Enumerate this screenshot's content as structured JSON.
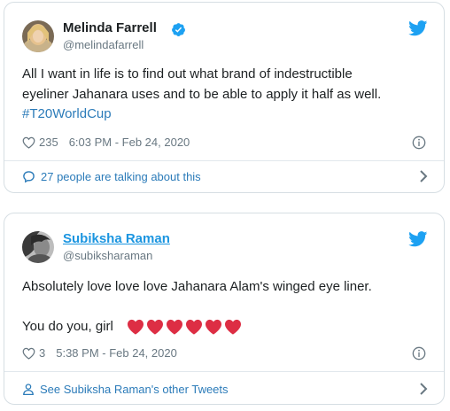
{
  "tweet1": {
    "name": "Melinda Farrell",
    "handle": "@melindafarrell",
    "text_line1": "All I want in life is to find out what brand of indestructible",
    "text_line2": "eyeliner Jahanara uses and to be able to apply it half as well.",
    "hashtag": "#T20WorldCup",
    "likes": "235",
    "timestamp": "6:03 PM - Feb 24, 2020",
    "footer_text": "27 people are talking about this"
  },
  "tweet2": {
    "name": "Subiksha Raman",
    "handle": "@subiksharaman",
    "text_line1": "Absolutely love love love Jahanara Alam's winged eye liner.",
    "text_line2": "You do you, girl",
    "heart_emoji_count": 6,
    "likes": "3",
    "timestamp": "5:38 PM - Feb 24, 2020",
    "footer_text": "See Subiksha Raman's other Tweets"
  },
  "icons": {
    "twitter_bird": "twitter-bird-icon",
    "verified": "verified-badge-icon",
    "like": "heart-icon",
    "info": "info-icon",
    "conversation": "speech-bubble-icon",
    "person": "person-icon",
    "chevron": "chevron-right-icon"
  },
  "colors": {
    "twitter_blue": "#1da1f2",
    "link_blue": "#2b7bb9",
    "heart_red": "#dd2e44",
    "muted_gray": "#697882",
    "border": "#d6dee3"
  }
}
